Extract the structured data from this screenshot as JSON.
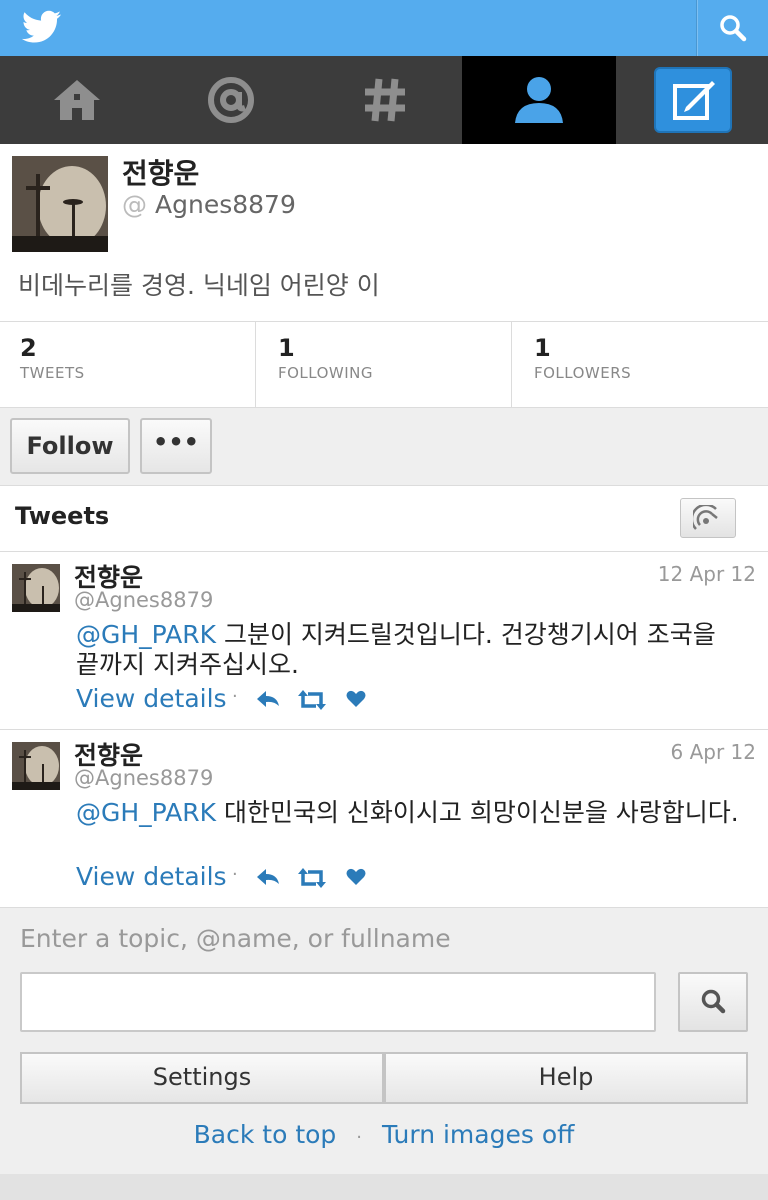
{
  "colors": {
    "brand": "#55acee",
    "link": "#2b7bb9",
    "nav_bg": "#3c3c3c"
  },
  "topbar": {
    "logo_icon": "twitter-bird-icon",
    "search_icon": "search-icon"
  },
  "nav": {
    "items": [
      {
        "name": "home",
        "icon": "home-icon"
      },
      {
        "name": "connect",
        "icon": "at-icon"
      },
      {
        "name": "discover",
        "icon": "hashtag-icon"
      },
      {
        "name": "me",
        "icon": "person-icon",
        "active": true
      }
    ],
    "compose_icon": "compose-icon"
  },
  "profile": {
    "name": "전향운",
    "handle_at": "@",
    "handle": "Agnes8879",
    "bio": "비데누리를 경영. 닉네임 어린양 이"
  },
  "stats": [
    {
      "value": "2",
      "label": "TWEETS"
    },
    {
      "value": "1",
      "label": "FOLLOWING"
    },
    {
      "value": "1",
      "label": "FOLLOWERS"
    }
  ],
  "actions": {
    "follow_label": "Follow",
    "more_label": "•••"
  },
  "tweets_header": {
    "title": "Tweets"
  },
  "tweets": [
    {
      "name": "전향운",
      "handle": "@Agnes8879",
      "date": "12 Apr 12",
      "mention": "@GH_PARK",
      "text": " 그분이 지켜드릴것입니다. 건강챙기시어 조국을 끝까지 지켜주십시오.",
      "view_label": "View details",
      "dot": "·"
    },
    {
      "name": "전향운",
      "handle": "@Agnes8879",
      "date": "6 Apr 12",
      "mention": "@GH_PARK",
      "text": " 대한민국의 신화이시고 희망이신분을 사랑합니다.",
      "view_label": "View details",
      "dot": "·"
    }
  ],
  "footer": {
    "search_placeholder": "Enter a topic, @name, or fullname",
    "search_value": "",
    "settings_label": "Settings",
    "help_label": "Help",
    "back_to_top": "Back to top",
    "separator": "·",
    "images_off": "Turn images off"
  }
}
